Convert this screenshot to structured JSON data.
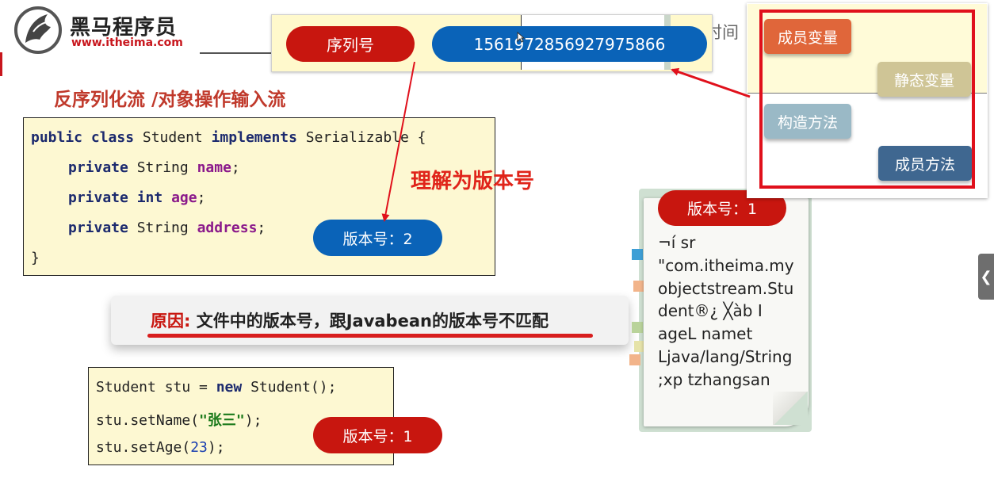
{
  "logo": {
    "name_cn": "黑马程序员",
    "url": "www.itheima.com"
  },
  "serial_panel": {
    "label": "序列号",
    "value": "1561972856927975866",
    "bg_text": "时间"
  },
  "section_title": "反序列化流 /对象操作输入流",
  "code_class": {
    "lines": [
      [
        "public class",
        " Student ",
        "implements",
        " Serializable {"
      ],
      [
        "private",
        " String ",
        "name",
        ";"
      ],
      [
        "private int",
        " ",
        "age",
        ";"
      ],
      [
        "private",
        " String ",
        "address",
        ";"
      ],
      [
        "}"
      ]
    ]
  },
  "code_create": {
    "lines": [
      [
        "Student stu = ",
        "new",
        " Student();"
      ],
      [
        "stu.setName(",
        "\"张三\"",
        ");"
      ],
      [
        "stu.setAge(",
        "23",
        ");"
      ]
    ]
  },
  "version_pills": {
    "class_version": "版本号：2",
    "object_version": "版本号：1"
  },
  "understand_text": "理解为版本号",
  "reason": {
    "label": "原因:",
    "text": " 文件中的版本号，跟Javabean的版本号不匹配"
  },
  "notepad": {
    "version": "版本号：1",
    "lines": [
      "¬í sr",
      "\"com.itheima.my",
      "objectstream.Stu",
      "dent®¿ ╳àb I",
      "ageL namet",
      "Ljava/lang/String",
      ";xp   tzhangsan"
    ]
  },
  "members": {
    "member_var": "成员变量",
    "static_var": "静态变量",
    "constructor": "构造方法",
    "member_method": "成员方法"
  },
  "colors": {
    "red": "#c8160f",
    "blue": "#0a63b8",
    "code_bg": "#fdf8d2"
  },
  "icons": {
    "side_tab": "chevron-left-icon"
  }
}
